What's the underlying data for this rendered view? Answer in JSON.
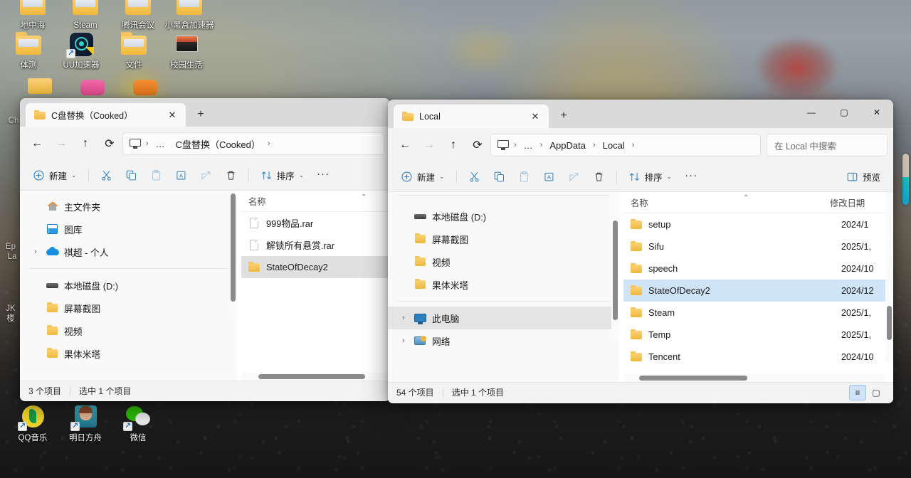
{
  "desktop": {
    "icons_top_clipped": [
      {
        "label": "地中海"
      },
      {
        "label": "Steam"
      },
      {
        "label": "腾讯会议"
      },
      {
        "label": "小黑盒加速器"
      }
    ],
    "icons_row2": [
      {
        "label": "体测",
        "icon": "folder-icon",
        "shortcut": false
      },
      {
        "label": "UU加速器",
        "icon": "uu-accelerator-icon",
        "shortcut": true
      },
      {
        "label": "文件",
        "icon": "folder-icon",
        "shortcut": false
      },
      {
        "label": "校园生活",
        "icon": "campus-life-icon",
        "shortcut": false
      }
    ],
    "icons_bottom": [
      {
        "label": "QQ音乐",
        "icon": "qq-music-icon",
        "shortcut": true
      },
      {
        "label": "明日方舟",
        "icon": "arknights-icon",
        "shortcut": true
      },
      {
        "label": "微信",
        "icon": "wechat-icon",
        "shortcut": true
      }
    ],
    "clipped_labels": [
      "Ch",
      "Ep",
      "La",
      "JK",
      "楼"
    ]
  },
  "window1": {
    "tab": {
      "title": "C盘替换（Cooked）",
      "close_label": "✕"
    },
    "new_tab_label": "+",
    "address": {
      "back_label": "←",
      "forward_label": "→",
      "up_label": "↑",
      "refresh_label": "⟳",
      "root_icon": "this-pc-icon",
      "crumbs": [
        "…",
        "C盘替换（Cooked）"
      ],
      "chevron": "›"
    },
    "toolbar": {
      "new_label": "新建",
      "new_caret": "⌄",
      "cut_label": "剪切",
      "copy_label": "复制",
      "paste_label": "粘贴",
      "rename_label": "重命名",
      "share_label": "共享",
      "delete_label": "删除",
      "sort_label": "排序",
      "sort_caret": "⌄",
      "more_label": "···"
    },
    "nav": [
      {
        "label": "主文件夹",
        "icon": "home-icon",
        "expandable": false
      },
      {
        "label": "图库",
        "icon": "gallery-icon",
        "expandable": false
      },
      {
        "label": "祺超 - 个人",
        "icon": "onedrive-cloud-icon",
        "expandable": true
      },
      {
        "label": "本地磁盘 (D:)",
        "icon": "drive-icon",
        "expandable": false,
        "after_sep": true
      },
      {
        "label": "屏幕截图",
        "icon": "folder-icon",
        "expandable": false
      },
      {
        "label": "视频",
        "icon": "folder-icon",
        "expandable": false
      },
      {
        "label": "果体米塔",
        "icon": "folder-icon",
        "expandable": false
      }
    ],
    "columns": [
      "名称"
    ],
    "files": [
      {
        "name": "999物品.rar",
        "icon": "file-icon",
        "selected": false
      },
      {
        "name": "解锁所有悬赏.rar",
        "icon": "file-icon",
        "selected": false
      },
      {
        "name": "StateOfDecay2",
        "icon": "folder-icon",
        "selected": true
      }
    ],
    "status": {
      "count": "3 个项目",
      "selection": "选中 1 个项目"
    }
  },
  "window2": {
    "tab": {
      "title": "Local",
      "close_label": "✕"
    },
    "new_tab_label": "+",
    "controls": {
      "minimize": "—",
      "maximize": "▢",
      "close": "✕"
    },
    "address": {
      "back_label": "←",
      "forward_label": "→",
      "up_label": "↑",
      "refresh_label": "⟳",
      "root_icon": "this-pc-icon",
      "crumbs": [
        "…",
        "AppData",
        "Local"
      ],
      "chevron": "›"
    },
    "search": {
      "placeholder": "在 Local 中搜索"
    },
    "toolbar": {
      "new_label": "新建",
      "new_caret": "⌄",
      "cut_label": "剪切",
      "copy_label": "复制",
      "paste_label": "粘贴",
      "rename_label": "重命名",
      "share_label": "共享",
      "delete_label": "删除",
      "sort_label": "排序",
      "sort_caret": "⌄",
      "more_label": "···",
      "preview_label": "预览"
    },
    "nav": [
      {
        "label": "本地磁盘 (D:)",
        "icon": "drive-icon",
        "expandable": false
      },
      {
        "label": "屏幕截图",
        "icon": "folder-icon",
        "expandable": false
      },
      {
        "label": "视频",
        "icon": "folder-icon",
        "expandable": false
      },
      {
        "label": "果体米塔",
        "icon": "folder-icon",
        "expandable": false
      },
      {
        "label": "此电脑",
        "icon": "this-pc-icon",
        "expandable": true,
        "selected": true,
        "after_sep": true
      },
      {
        "label": "网络",
        "icon": "network-icon",
        "expandable": true
      }
    ],
    "columns": [
      "名称",
      "修改日期"
    ],
    "files": [
      {
        "name": "setup",
        "date": "2024/1",
        "icon": "folder-icon",
        "selected": false
      },
      {
        "name": "Sifu",
        "date": "2025/1,",
        "icon": "folder-icon",
        "selected": false
      },
      {
        "name": "speech",
        "date": "2024/10",
        "icon": "folder-icon",
        "selected": false
      },
      {
        "name": "StateOfDecay2",
        "date": "2024/12",
        "icon": "folder-icon",
        "selected": true
      },
      {
        "name": "Steam",
        "date": "2025/1,",
        "icon": "folder-icon",
        "selected": false
      },
      {
        "name": "Temp",
        "date": "2025/1,",
        "icon": "folder-icon",
        "selected": false
      },
      {
        "name": "Tencent",
        "date": "2024/10",
        "icon": "folder-icon",
        "selected": false
      }
    ],
    "status": {
      "count": "54 个项目",
      "selection": "选中 1 个项目"
    },
    "view_buttons": [
      {
        "name": "details-view-button",
        "glyph": "≡",
        "active": true
      },
      {
        "name": "large-icons-view-button",
        "glyph": "▢",
        "active": false
      }
    ]
  },
  "colors": {
    "selection_blue": "#cfe4f7",
    "selection_grey": "#e0e0e0",
    "titlebar": "#dadada",
    "chrome": "#f3f3f3",
    "accent_icon_blue": "#2f7fbf"
  }
}
